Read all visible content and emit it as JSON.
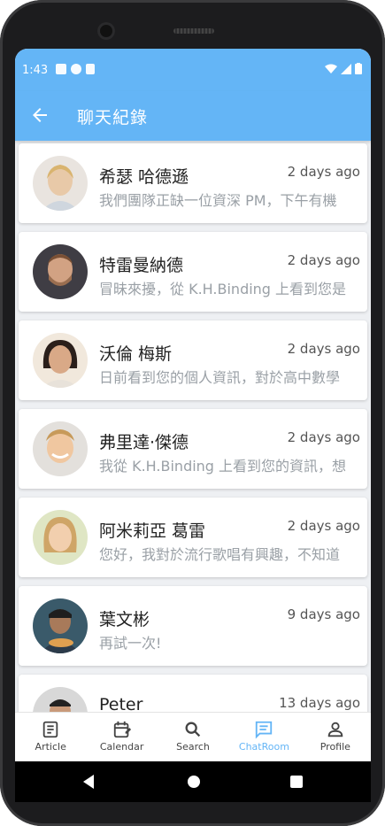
{
  "status_bar": {
    "time": "1:43"
  },
  "app_bar": {
    "title": "聊天紀錄"
  },
  "chats": [
    {
      "name": "希瑟 哈德遜",
      "time": "2 days ago",
      "preview": "我們團隊正缺一位資深 PM，下午有機",
      "avatar_color": "#e8c9a8"
    },
    {
      "name": "特雷曼納德",
      "time": "2 days ago",
      "preview": "冒昧來擾，從 K.H.Binding 上看到您是",
      "avatar_color": "#b58b6c"
    },
    {
      "name": "沃倫 梅斯",
      "time": "2 days ago",
      "preview": "日前看到您的個人資訊，對於高中數學",
      "avatar_color": "#6b4a3a"
    },
    {
      "name": "弗里達·傑德",
      "time": "2 days ago",
      "preview": "我從 K.H.Binding 上看到您的資訊，想",
      "avatar_color": "#f0c7a0"
    },
    {
      "name": "阿米莉亞 葛雷",
      "time": "2 days ago",
      "preview": "您好，我對於流行歌唱有興趣，不知道",
      "avatar_color": "#d9b58a"
    },
    {
      "name": "葉文彬",
      "time": "9 days ago",
      "preview": "再試一次!",
      "avatar_color": "#7a5a43"
    },
    {
      "name": "Peter",
      "time": "13 days ago",
      "preview": "",
      "avatar_color": "#8a6a55"
    }
  ],
  "nav": [
    {
      "label": "Article",
      "icon": "article-icon"
    },
    {
      "label": "Calendar",
      "icon": "calendar-icon"
    },
    {
      "label": "Search",
      "icon": "search-icon"
    },
    {
      "label": "ChatRoom",
      "icon": "chat-icon"
    },
    {
      "label": "Profile",
      "icon": "profile-icon"
    }
  ],
  "colors": {
    "primary": "#64b5f6"
  }
}
